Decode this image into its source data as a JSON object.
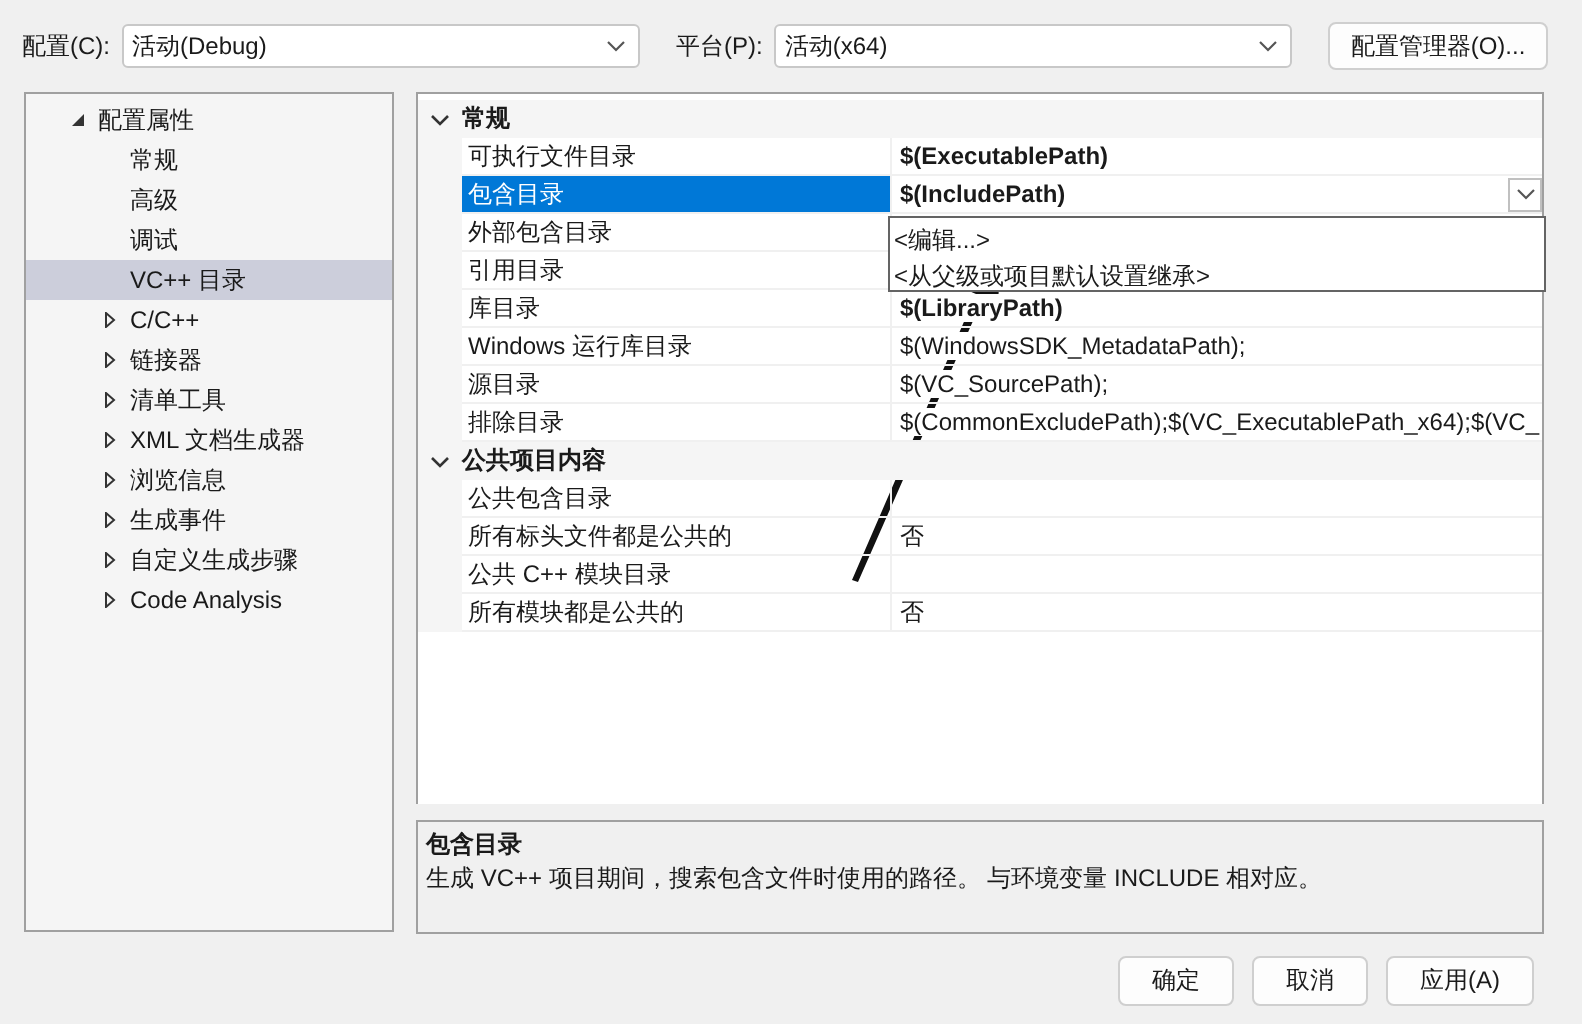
{
  "toolbar": {
    "config_label": "配置(C):",
    "config_value": "活动(Debug)",
    "platform_label": "平台(P):",
    "platform_value": "活动(x64)",
    "manager_button": "配置管理器(O)..."
  },
  "tree": [
    {
      "label": "配置属性",
      "expanded": true,
      "selected": false,
      "children": [
        {
          "label": "常规",
          "has_children": false,
          "selected": false
        },
        {
          "label": "高级",
          "has_children": false,
          "selected": false
        },
        {
          "label": "调试",
          "has_children": false,
          "selected": false
        },
        {
          "label": "VC++ 目录",
          "has_children": false,
          "selected": true
        },
        {
          "label": "C/C++",
          "has_children": true,
          "selected": false
        },
        {
          "label": "链接器",
          "has_children": true,
          "selected": false
        },
        {
          "label": "清单工具",
          "has_children": true,
          "selected": false
        },
        {
          "label": "XML 文档生成器",
          "has_children": true,
          "selected": false
        },
        {
          "label": "浏览信息",
          "has_children": true,
          "selected": false
        },
        {
          "label": "生成事件",
          "has_children": true,
          "selected": false
        },
        {
          "label": "自定义生成步骤",
          "has_children": true,
          "selected": false
        },
        {
          "label": "Code Analysis",
          "has_children": true,
          "selected": false
        }
      ]
    }
  ],
  "grid": [
    {
      "category": "常规",
      "expanded": true,
      "rows": [
        {
          "name": "可执行文件目录",
          "value": "$(ExecutablePath)",
          "modified": true,
          "selected": false
        },
        {
          "name": "包含目录",
          "value": "$(IncludePath)",
          "modified": true,
          "selected": true
        },
        {
          "name": "外部包含目录",
          "selected": false
        },
        {
          "name": "引用目录",
          "selected": false
        },
        {
          "name": "库目录",
          "value": "$(LibraryPath)",
          "modified": true,
          "selected": false
        },
        {
          "name": "Windows 运行库目录",
          "value": "$(WindowsSDK_MetadataPath);",
          "modified": false,
          "selected": false
        },
        {
          "name": "源目录",
          "value": "$(VC_SourcePath);",
          "modified": false,
          "selected": false
        },
        {
          "name": "排除目录",
          "value": "$(CommonExcludePath);$(VC_ExecutablePath_x64);$(VC_",
          "modified": false,
          "selected": false
        }
      ]
    },
    {
      "category": "公共项目内容",
      "expanded": true,
      "rows": [
        {
          "name": "公共包含目录",
          "selected": false
        },
        {
          "name": "所有标头文件都是公共的",
          "value": "否",
          "modified": false,
          "selected": false
        },
        {
          "name": "公共 C++ 模块目录",
          "selected": false
        },
        {
          "name": "所有模块都是公共的",
          "value": "否",
          "modified": false,
          "selected": false
        }
      ]
    }
  ],
  "dropdown_options": [
    "<编辑...>",
    "<从父级或项目默认设置继承>"
  ],
  "description": {
    "title": "包含目录",
    "text": "生成 VC++ 项目期间，搜索包含文件时使用的路径。  与环境变量 INCLUDE 相对应。"
  },
  "buttons": [
    "确定",
    "取消",
    "应用(A)"
  ]
}
